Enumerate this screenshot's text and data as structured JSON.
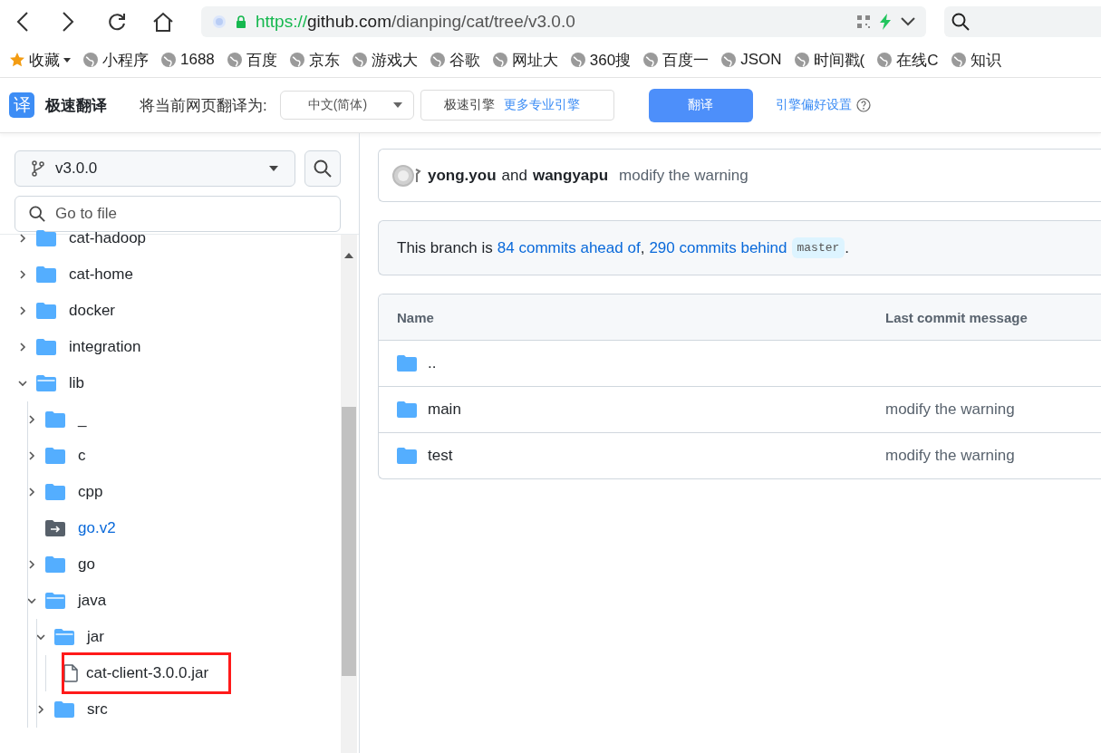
{
  "address_bar": {
    "scheme": "https://",
    "host": "github.com",
    "path": "/dianping/cat/tree/v3.0.0"
  },
  "bookmarks": [
    {
      "label": "收藏",
      "kind": "star"
    },
    {
      "label": "小程序",
      "kind": "site"
    },
    {
      "label": "1688",
      "kind": "site"
    },
    {
      "label": "百度",
      "kind": "site"
    },
    {
      "label": "京东",
      "kind": "site"
    },
    {
      "label": "游戏大",
      "kind": "site"
    },
    {
      "label": "谷歌",
      "kind": "site"
    },
    {
      "label": "网址大",
      "kind": "site"
    },
    {
      "label": "360搜",
      "kind": "site"
    },
    {
      "label": "百度一",
      "kind": "site"
    },
    {
      "label": "JSON",
      "kind": "site"
    },
    {
      "label": "时间戳(",
      "kind": "site"
    },
    {
      "label": "在线C",
      "kind": "site"
    },
    {
      "label": "知识",
      "kind": "site"
    }
  ],
  "translate_bar": {
    "logo": "译",
    "title": "极速翻译",
    "prompt": "将当前网页翻译为:",
    "language": "中文(简体)",
    "engine": "极速引擎",
    "more_engines": "更多专业引擎",
    "button": "翻译",
    "settings": "引擎偏好设置"
  },
  "sidebar": {
    "branch": "v3.0.0",
    "search": {
      "placeholder": "Go to file"
    },
    "tree": [
      {
        "name": "cat-hadoop",
        "kind": "folder",
        "expanded": false
      },
      {
        "name": "cat-home",
        "kind": "folder",
        "expanded": false
      },
      {
        "name": "docker",
        "kind": "folder",
        "expanded": false
      },
      {
        "name": "integration",
        "kind": "folder",
        "expanded": false
      },
      {
        "name": "lib",
        "kind": "folder",
        "expanded": true,
        "children": [
          {
            "name": "_",
            "kind": "folder",
            "expanded": false
          },
          {
            "name": "c",
            "kind": "folder",
            "expanded": false
          },
          {
            "name": "cpp",
            "kind": "folder",
            "expanded": false
          },
          {
            "name": "go.v2",
            "kind": "symlink"
          },
          {
            "name": "go",
            "kind": "folder",
            "expanded": false
          },
          {
            "name": "java",
            "kind": "folder",
            "expanded": true,
            "children": [
              {
                "name": "jar",
                "kind": "folder",
                "expanded": true,
                "children": [
                  {
                    "name": "cat-client-3.0.0.jar",
                    "kind": "file",
                    "highlighted": true
                  }
                ]
              },
              {
                "name": "src",
                "kind": "folder",
                "expanded": false
              }
            ]
          }
        ]
      }
    ]
  },
  "commit": {
    "author1": "yong.you",
    "joiner": "and",
    "author2": "wangyapu",
    "message": "modify the warning"
  },
  "branch_status": {
    "prefix": "This branch is",
    "ahead": "84 commits ahead of",
    "comma": ",",
    "behind": "290 commits behind",
    "base": "master",
    "suffix": "."
  },
  "table": {
    "columns": [
      "Name",
      "Last commit message"
    ],
    "rows": [
      {
        "name": "..",
        "message": ""
      },
      {
        "name": "main",
        "message": "modify the warning"
      },
      {
        "name": "test",
        "message": "modify the warning"
      }
    ]
  }
}
